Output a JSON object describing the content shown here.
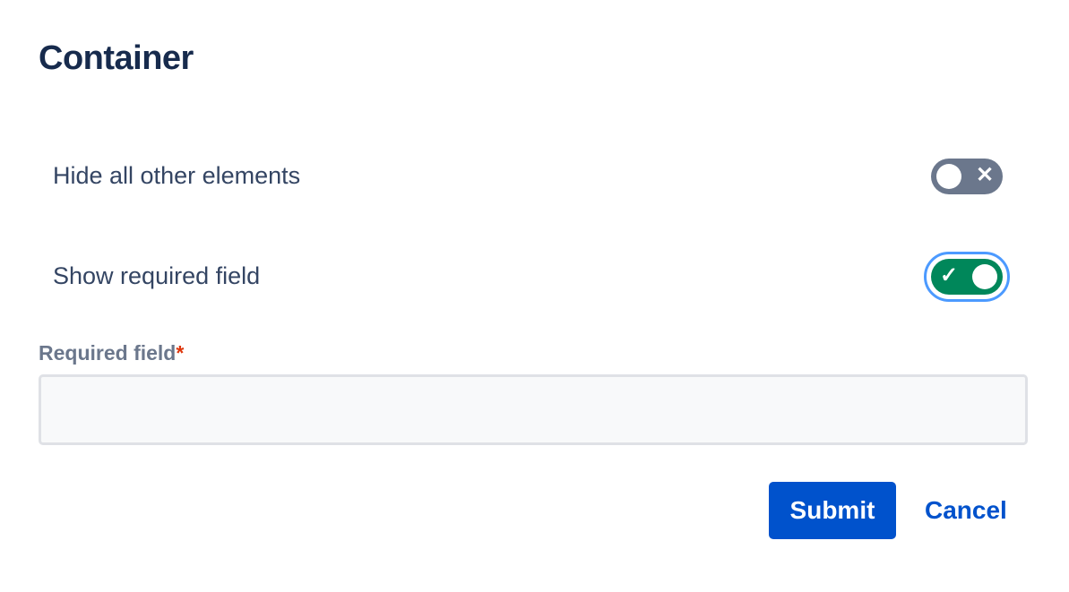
{
  "title": "Container",
  "toggles": [
    {
      "label": "Hide all other elements",
      "checked": false,
      "icon": "close-icon"
    },
    {
      "label": "Show required field",
      "checked": true,
      "icon": "check-icon"
    }
  ],
  "field": {
    "label": "Required field",
    "required_marker": "*",
    "value": ""
  },
  "buttons": {
    "submit": "Submit",
    "cancel": "Cancel"
  },
  "colors": {
    "toggle_on": "#00875a",
    "toggle_off": "#6b778c",
    "primary": "#0052cc",
    "focus": "#4c9aff"
  }
}
